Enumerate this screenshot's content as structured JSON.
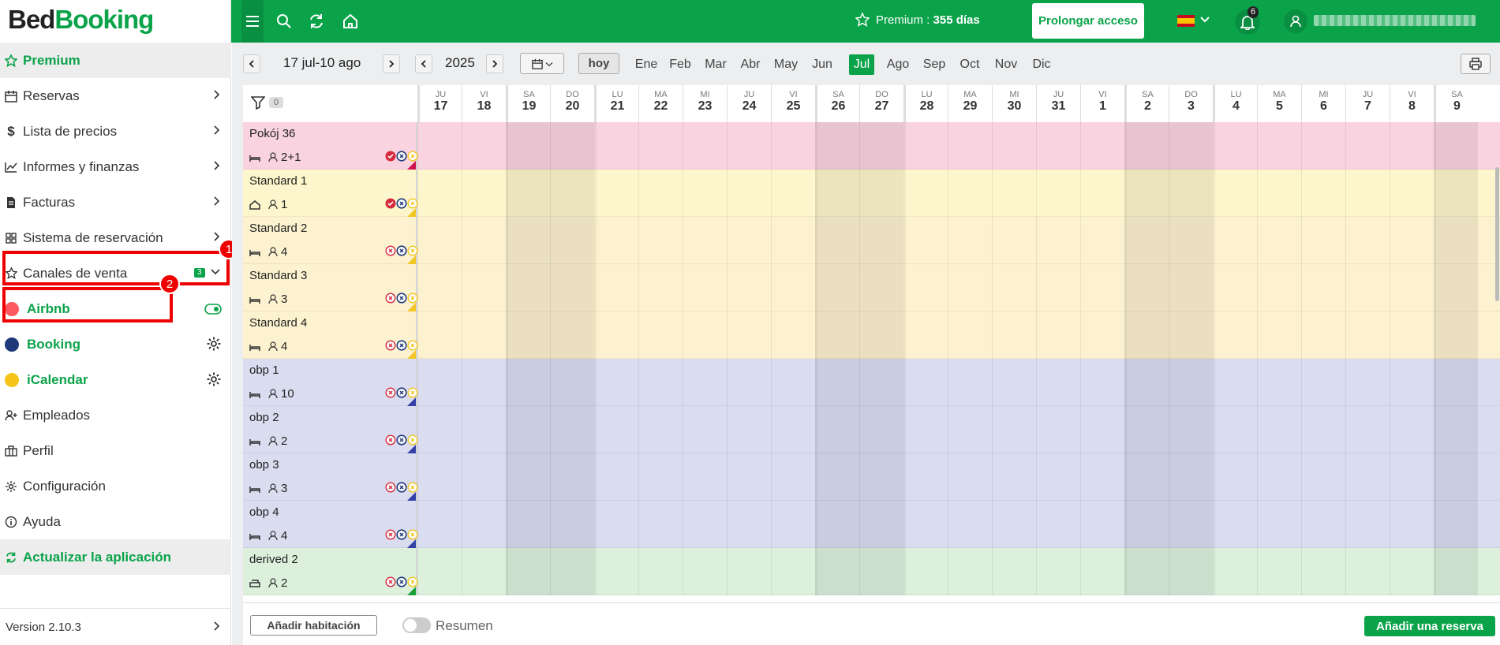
{
  "logo": {
    "part1": "Bed",
    "part2": "Booking"
  },
  "topbar": {
    "premium_label": "Premium : ",
    "premium_days": "355 días",
    "prolong_label": "Prolongar acceso",
    "notifications_count": "6"
  },
  "sidebar": {
    "premium": "Premium",
    "items": [
      {
        "label": "Reservas",
        "icon": "calendar-icon"
      },
      {
        "label": "Lista de precios",
        "icon": "dollar-icon"
      },
      {
        "label": "Informes y finanzas",
        "icon": "chart-icon"
      },
      {
        "label": "Facturas",
        "icon": "invoice-icon"
      },
      {
        "label": "Sistema de reservación",
        "icon": "grid-icon"
      },
      {
        "label": "Canales de venta",
        "icon": "star-icon",
        "badge": "3"
      }
    ],
    "channels": [
      {
        "label": "Airbnb",
        "color": "#ff5a5f"
      },
      {
        "label": "Booking",
        "color": "#1f3a7a"
      },
      {
        "label": "iCalendar",
        "color": "#f5c518"
      }
    ],
    "bottom_items": [
      {
        "label": "Empleados",
        "icon": "add-user-icon"
      },
      {
        "label": "Perfil",
        "icon": "briefcase-icon"
      },
      {
        "label": "Configuración",
        "icon": "gear-icon"
      },
      {
        "label": "Ayuda",
        "icon": "info-icon"
      }
    ],
    "update": "Actualizar la aplicación",
    "version": "Version 2.10.3"
  },
  "annotations": {
    "one": "1",
    "two": "2"
  },
  "nav": {
    "range": "17 jul-10 ago",
    "year": "2025",
    "today": "hoy",
    "months": [
      "Ene",
      "Feb",
      "Mar",
      "Abr",
      "May",
      "Jun",
      "Jul",
      "Ago",
      "Sep",
      "Oct",
      "Nov",
      "Dic"
    ],
    "active_month": "Jul"
  },
  "grid": {
    "filter_count": "0",
    "days": [
      {
        "dw": "JU",
        "dn": "17"
      },
      {
        "dw": "VI",
        "dn": "18"
      },
      {
        "dw": "SA",
        "dn": "19"
      },
      {
        "dw": "DO",
        "dn": "20"
      },
      {
        "dw": "LU",
        "dn": "21"
      },
      {
        "dw": "MA",
        "dn": "22"
      },
      {
        "dw": "MI",
        "dn": "23"
      },
      {
        "dw": "JU",
        "dn": "24"
      },
      {
        "dw": "VI",
        "dn": "25"
      },
      {
        "dw": "SA",
        "dn": "26"
      },
      {
        "dw": "DO",
        "dn": "27"
      },
      {
        "dw": "LU",
        "dn": "28"
      },
      {
        "dw": "MA",
        "dn": "29"
      },
      {
        "dw": "MI",
        "dn": "30"
      },
      {
        "dw": "JU",
        "dn": "31"
      },
      {
        "dw": "VI",
        "dn": "1"
      },
      {
        "dw": "SA",
        "dn": "2"
      },
      {
        "dw": "DO",
        "dn": "3"
      },
      {
        "dw": "LU",
        "dn": "4"
      },
      {
        "dw": "MA",
        "dn": "5"
      },
      {
        "dw": "MI",
        "dn": "6"
      },
      {
        "dw": "JU",
        "dn": "7"
      },
      {
        "dw": "VI",
        "dn": "8"
      },
      {
        "dw": "SA",
        "dn": "9"
      }
    ],
    "rooms": [
      {
        "name": "Pokój 36",
        "capacity": "2+1",
        "bg": "#f9d3df",
        "tri": "#d0114f",
        "bed": "bed",
        "s1": "ok"
      },
      {
        "name": "Standard 1",
        "capacity": "1",
        "bg": "#fdf6cc",
        "tri": "#f2c623",
        "bed": "house",
        "s1": "ok"
      },
      {
        "name": "Standard 2",
        "capacity": "4",
        "bg": "#fcf2cf",
        "tri": "#f2c623",
        "bed": "bed",
        "s1": "x"
      },
      {
        "name": "Standard 3",
        "capacity": "3",
        "bg": "#fcf2cf",
        "tri": "#f2c623",
        "bed": "bed",
        "s1": "x"
      },
      {
        "name": "Standard 4",
        "capacity": "4",
        "bg": "#fcf2cf",
        "tri": "#f2c623",
        "bed": "bed",
        "s1": "x"
      },
      {
        "name": "obp 1",
        "capacity": "10",
        "bg": "#dadcf0",
        "tri": "#3340a8",
        "bed": "bed",
        "s1": "x"
      },
      {
        "name": "obp 2",
        "capacity": "2",
        "bg": "#dadcf0",
        "tri": "#3340a8",
        "bed": "bed",
        "s1": "x"
      },
      {
        "name": "obp 3",
        "capacity": "3",
        "bg": "#dadcf0",
        "tri": "#3340a8",
        "bed": "bed",
        "s1": "x"
      },
      {
        "name": "obp 4",
        "capacity": "4",
        "bg": "#dadcf0",
        "tri": "#3340a8",
        "bed": "bed",
        "s1": "x"
      },
      {
        "name": "derived 2",
        "capacity": "2",
        "bg": "#dcf0dc",
        "tri": "#18a03c",
        "bed": "sofa",
        "s1": "x"
      }
    ]
  },
  "footer": {
    "add_room": "Añadir habitación",
    "summary": "Resumen",
    "add_reservation": "Añadir una reserva"
  }
}
